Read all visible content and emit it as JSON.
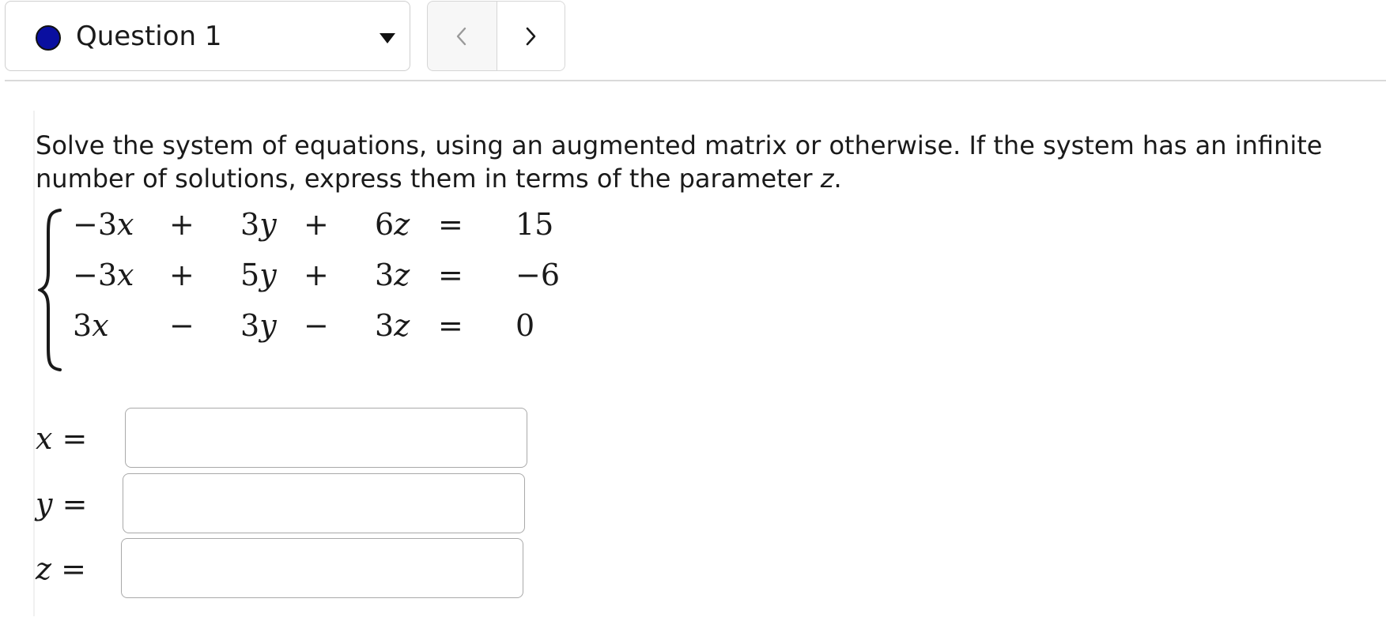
{
  "header": {
    "question_selector": {
      "label": "Question 1",
      "dot_color": "#0a0fa0"
    },
    "nav": {
      "prev_icon": "chevron-left-icon",
      "next_icon": "chevron-right-icon"
    }
  },
  "question": {
    "prompt_before_var": "Solve the system of equations, using an augmented matrix or otherwise. If the system has an infinite number of solutions, express them in terms of the parameter ",
    "parameter": "z",
    "prompt_after_var": "."
  },
  "system": {
    "rows": [
      {
        "t1": "−3",
        "v1": "x",
        "op1": "+",
        "t2": "3",
        "v2": "y",
        "op2": "+",
        "t3": "6",
        "v3": "z",
        "eq": "=",
        "rhs": "15"
      },
      {
        "t1": "−3",
        "v1": "x",
        "op1": "+",
        "t2": "5",
        "v2": "y",
        "op2": "+",
        "t3": "3",
        "v3": "z",
        "eq": "=",
        "rhs": "−6"
      },
      {
        "t1": "3",
        "v1": "x",
        "op1": "−",
        "t2": "3",
        "v2": "y",
        "op2": "−",
        "t3": "3",
        "v3": "z",
        "eq": "=",
        "rhs": "0"
      }
    ]
  },
  "answers": [
    {
      "var": "x",
      "eq": "=",
      "value": ""
    },
    {
      "var": "y",
      "eq": "=",
      "value": ""
    },
    {
      "var": "z",
      "eq": "=",
      "value": ""
    }
  ]
}
